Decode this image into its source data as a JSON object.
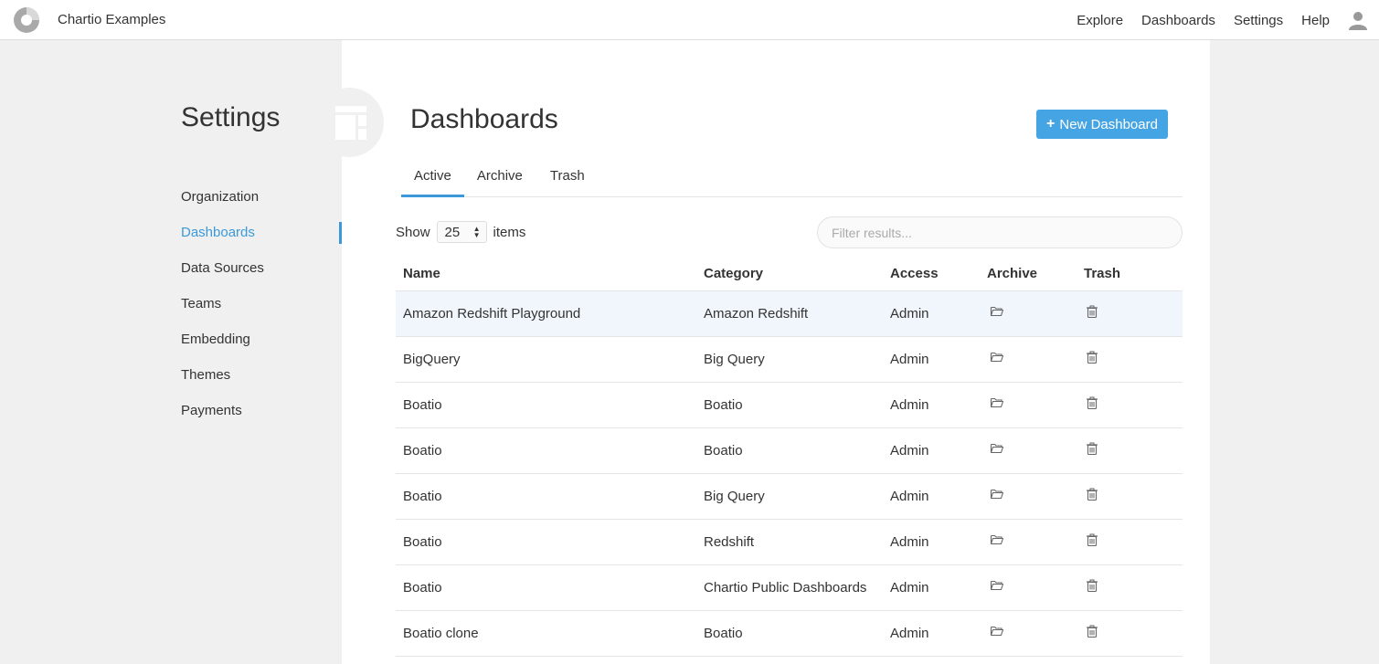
{
  "topbar": {
    "org_name": "Chartio Examples",
    "nav": [
      "Explore",
      "Dashboards",
      "Settings",
      "Help"
    ],
    "logo_icon": "chartio-logo",
    "user_icon": "user-icon"
  },
  "sidebar": {
    "title": "Settings",
    "items": [
      {
        "label": "Organization"
      },
      {
        "label": "Dashboards",
        "active": true
      },
      {
        "label": "Data Sources"
      },
      {
        "label": "Teams"
      },
      {
        "label": "Embedding"
      },
      {
        "label": "Themes"
      },
      {
        "label": "Payments"
      }
    ]
  },
  "main": {
    "title": "Dashboards",
    "new_button": "New Dashboard",
    "tabs": [
      {
        "label": "Active",
        "active": true
      },
      {
        "label": "Archive"
      },
      {
        "label": "Trash"
      }
    ],
    "show_label": "Show",
    "items_label": "items",
    "page_size": "25",
    "filter_placeholder": "Filter results...",
    "columns": [
      "Name",
      "Category",
      "Access",
      "Archive",
      "Trash"
    ],
    "rows": [
      {
        "name": "Amazon Redshift Playground",
        "category": "Amazon Redshift",
        "access": "Admin"
      },
      {
        "name": "BigQuery",
        "category": "Big Query",
        "access": "Admin"
      },
      {
        "name": "Boatio",
        "category": "Boatio",
        "access": "Admin"
      },
      {
        "name": "Boatio",
        "category": "Boatio",
        "access": "Admin"
      },
      {
        "name": "Boatio",
        "category": "Big Query",
        "access": "Admin"
      },
      {
        "name": "Boatio",
        "category": "Redshift",
        "access": "Admin"
      },
      {
        "name": "Boatio",
        "category": "Chartio Public Dashboards",
        "access": "Admin"
      },
      {
        "name": "Boatio clone",
        "category": "Boatio",
        "access": "Admin"
      }
    ]
  },
  "colors": {
    "accent": "#3b99d9",
    "button": "#45a4e4",
    "row_highlight": "#f0f6fb",
    "background": "#f0f0f0"
  }
}
